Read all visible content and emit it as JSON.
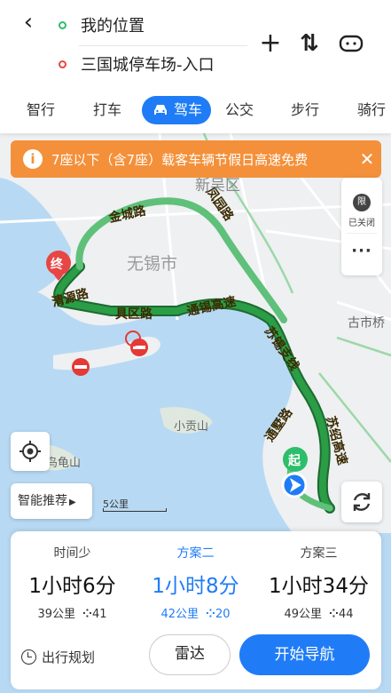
{
  "header": {
    "back_icon": "back-arrow-icon",
    "origin": "我的位置",
    "destination": "三国城停车场-入口",
    "add_icon": "plus-icon",
    "swap_icon": "swap-icon",
    "more_icon": "more-icon"
  },
  "modes": [
    {
      "label": "智行"
    },
    {
      "label": "打车"
    },
    {
      "label": "驾车",
      "active": true
    },
    {
      "label": "公交"
    },
    {
      "label": "步行"
    },
    {
      "label": "骑行"
    }
  ],
  "notice": {
    "icon": "info-icon",
    "text": "7座以下（含7座）载客车辆节假日高速免费",
    "close_icon": "close-icon"
  },
  "map": {
    "labels": {
      "district": "新吴区",
      "city": "无锡市",
      "town": "古市桥",
      "hill1": "小贡山",
      "hill2": "鸟龟山"
    },
    "roads": {
      "r1": "金城路",
      "r2": "清源路",
      "r3": "具区路",
      "r4": "通锡高速",
      "r5": "苏锡支线",
      "r6": "苏绍高速",
      "r7": "通墅路",
      "r8": "凤园路"
    },
    "markers": {
      "start": "起",
      "end": "终"
    },
    "colors": {
      "route_green": "#2a9d46",
      "route_light": "#5fc07a",
      "water": "#b8d9f3",
      "land": "#eef0f2"
    }
  },
  "side_panel": {
    "limit_badge": "限",
    "limit_label": "已关闭",
    "more_label": "···"
  },
  "controls": {
    "locate_icon": "locate-icon",
    "refresh_icon": "refresh-icon",
    "smart_label": "智能推荐",
    "scale_label": "5公里"
  },
  "plans": [
    {
      "label": "时间少",
      "time": "1小时6分",
      "distance": "39公里",
      "lights": "41",
      "selected": false
    },
    {
      "label": "方案二",
      "time": "1小时8分",
      "distance": "42公里",
      "lights": "20",
      "selected": true
    },
    {
      "label": "方案三",
      "time": "1小时34分",
      "distance": "49公里",
      "lights": "44",
      "selected": false
    }
  ],
  "actions": {
    "trip_plan": "出行规划",
    "radar": "雷达",
    "navigate": "开始导航"
  }
}
